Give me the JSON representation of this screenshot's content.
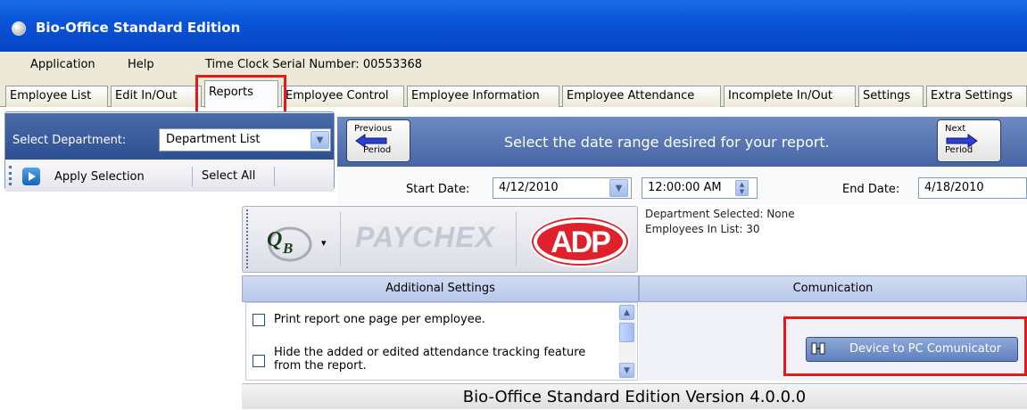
{
  "window": {
    "title": "Bio-Office Standard Edition"
  },
  "menu": {
    "items": [
      "Application",
      "Help"
    ],
    "serial": "Time Clock Serial Number: 00553368"
  },
  "tabs": [
    "Employee List",
    "Edit In/Out",
    "Reports",
    "Employee Control",
    "Employee Information",
    "Employee Attendance",
    "Incomplete In/Out",
    "Settings",
    "Extra Settings"
  ],
  "active_tab": "Reports",
  "department": {
    "label": "Select Department:",
    "selected": "Department List",
    "apply_label": "Apply Selection",
    "select_all_label": "Select All"
  },
  "date_range": {
    "prev_label_1": "Previous",
    "prev_label_2": "Period",
    "next_label_1": "Next",
    "next_label_2": "Period",
    "banner": "Select the date range desired for your report.",
    "start_label": "Start Date:",
    "start_value": "4/12/2010",
    "start_time": "12:00:00 AM",
    "end_label": "End Date:",
    "end_value": "4/18/2010"
  },
  "logos": {
    "paychex": "PAYCHEX",
    "qb_symbol": "QB"
  },
  "info": {
    "dept_selected": "Department Selected: None",
    "employees_count": "Employees In List: 30"
  },
  "sections": {
    "additional_settings": "Additional Settings",
    "communication": "Comunication"
  },
  "options": [
    "Print report one page per employee.",
    "Hide the added or edited attendance tracking feature",
    "from the report."
  ],
  "comm_button": "Device to PC Comunicator",
  "footer": "Bio-Office Standard Edition Version 4.0.0.0",
  "colors": {
    "title_bar": "#0a54d8",
    "highlight": "#e21a1a",
    "banner": "#4565a4"
  }
}
